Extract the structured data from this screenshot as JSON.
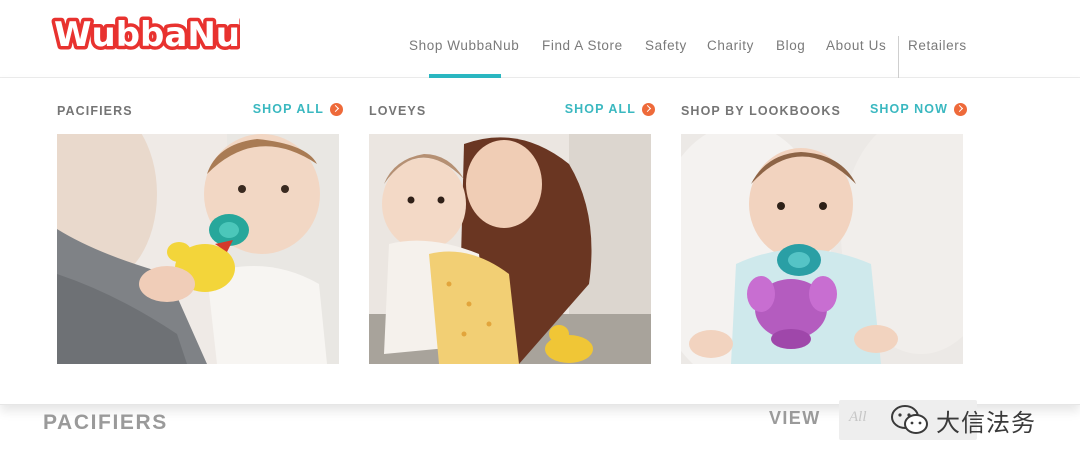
{
  "brand": {
    "logo_text": "WubbaNub"
  },
  "nav": {
    "items": [
      "Shop WubbaNub",
      "Find A Store",
      "Safety",
      "Charity",
      "Blog",
      "About Us",
      "Retailers"
    ],
    "active": "Shop WubbaNub"
  },
  "mega_menu": {
    "columns": [
      {
        "title": "PACIFIERS",
        "link": "SHOP ALL",
        "image": "baby-with-duck-pacifier-photo"
      },
      {
        "title": "LOVEYS",
        "link": "SHOP ALL",
        "image": "mother-and-baby-lovey-photo"
      },
      {
        "title": "SHOP BY LOOKBOOKS",
        "link": "SHOP NOW",
        "image": "baby-with-elephant-pacifier-photo"
      }
    ]
  },
  "page": {
    "section_title": "PACIFIERS",
    "view_label": "VIEW",
    "view_select_value": "All"
  },
  "watermark": {
    "text": "大信法务",
    "icon": "wechat-icon"
  },
  "colors": {
    "accent": "#2bb8c2",
    "arrow": "#ee6a3a",
    "logo_red": "#e8322f"
  }
}
